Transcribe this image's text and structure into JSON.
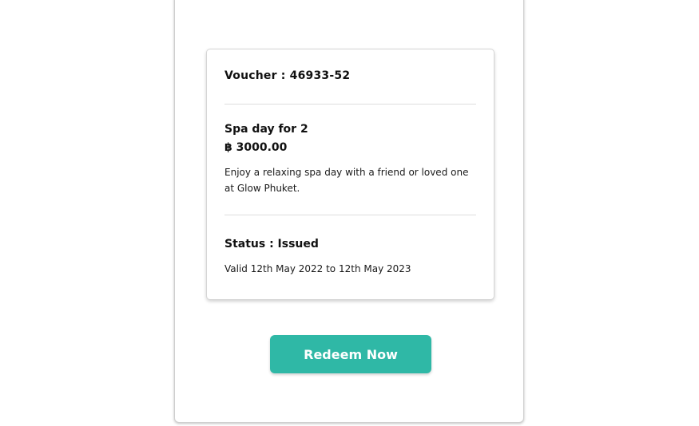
{
  "voucher": {
    "label": "Voucher : 46933-52"
  },
  "offer": {
    "title": "Spa day for 2",
    "price": "฿ 3000.00",
    "description": "Enjoy a relaxing spa day with a friend or loved one at Glow Phuket."
  },
  "status": {
    "label": "Status : Issued",
    "validity": "Valid 12th May 2022 to 12th May 2023"
  },
  "actions": {
    "redeem_label": "Redeem Now"
  },
  "colors": {
    "accent": "#2fb8a6"
  }
}
